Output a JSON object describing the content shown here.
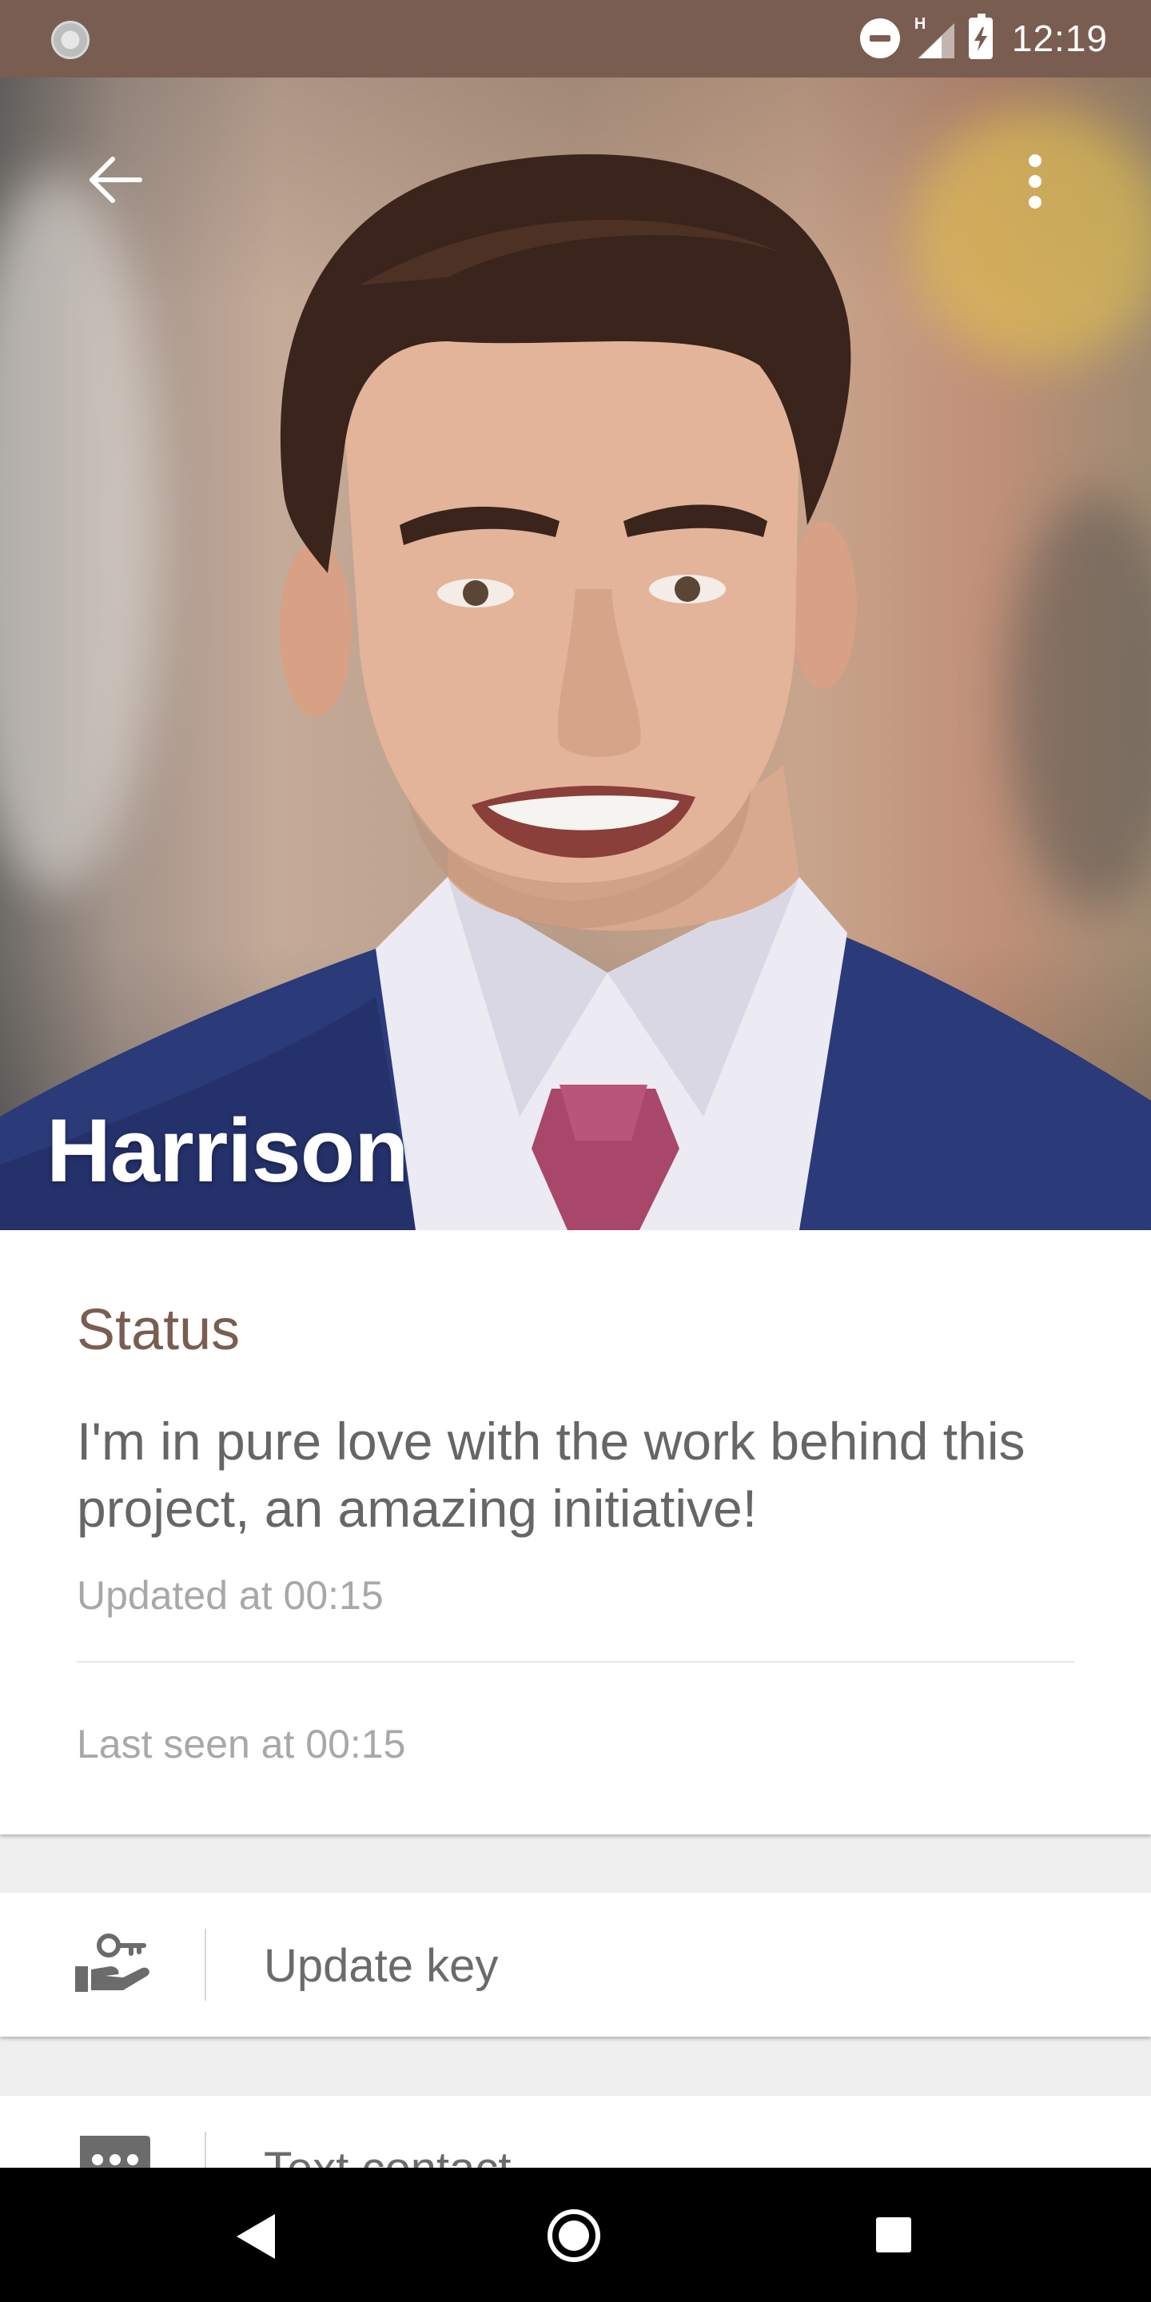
{
  "status_bar": {
    "time": "12:19",
    "network_label": "H",
    "icons": [
      "app-notification-icon",
      "do-not-disturb-icon",
      "signal-icon",
      "battery-charging-icon"
    ]
  },
  "header": {
    "name": "Harrison",
    "back_icon": "arrow-left-icon",
    "menu_icon": "more-vert-icon"
  },
  "status_card": {
    "heading": "Status",
    "text": "I'm in pure love with the work behind this project, an amazing initiative!",
    "updated": "Updated at 00:15",
    "last_seen": "Last seen at 00:15"
  },
  "actions": [
    {
      "label": "Update key",
      "icon": "key-in-hand-icon"
    },
    {
      "label": "Text contact",
      "icon": "chat-icon"
    }
  ],
  "colors": {
    "accent": "#7a5d51",
    "status_text": "#666666",
    "muted_text": "#a8a8a8"
  },
  "nav_bar": {
    "icons": [
      "nav-back-icon",
      "nav-home-icon",
      "nav-recents-icon"
    ]
  }
}
